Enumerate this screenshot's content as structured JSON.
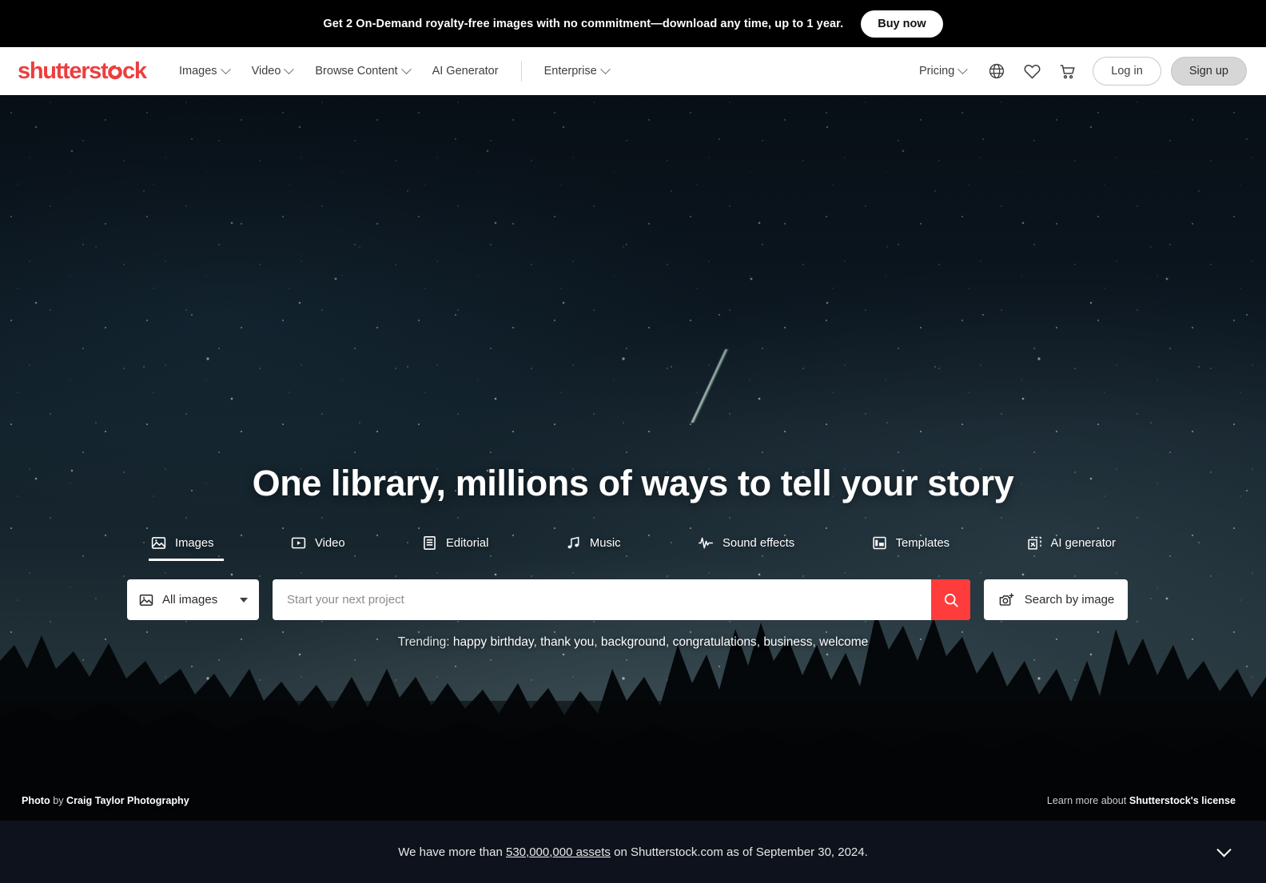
{
  "promo": {
    "text_bold_1": "Get 2 On-Demand",
    "text_light": " royalty-free images with no commitment—download any time, up to 1 year.",
    "full_text": "Get 2 On-Demand royalty-free images with no commitment—download any time, up to 1 year.",
    "button": "Buy now"
  },
  "header": {
    "logo": "shutterstock",
    "nav": [
      {
        "label": "Images",
        "has_caret": true
      },
      {
        "label": "Video",
        "has_caret": true
      },
      {
        "label": "Browse Content",
        "has_caret": true
      },
      {
        "label": "AI Generator",
        "has_caret": false
      },
      {
        "label": "Enterprise",
        "has_caret": true
      }
    ],
    "pricing": {
      "label": "Pricing",
      "has_caret": true
    },
    "icons": [
      "globe-icon",
      "heart-icon",
      "cart-icon"
    ],
    "login": "Log in",
    "signup": "Sign up",
    "brand_color": "#ec3e3e"
  },
  "hero": {
    "headline": "One library, millions of ways to tell your story",
    "tabs": [
      {
        "label": "Images",
        "icon": "image-icon",
        "active": true
      },
      {
        "label": "Video",
        "icon": "video-play-icon",
        "active": false
      },
      {
        "label": "Editorial",
        "icon": "document-lines-icon",
        "active": false
      },
      {
        "label": "Music",
        "icon": "music-note-icon",
        "active": false
      },
      {
        "label": "Sound effects",
        "icon": "waveform-icon",
        "active": false
      },
      {
        "label": "Templates",
        "icon": "layout-icon",
        "active": false
      },
      {
        "label": "AI generator",
        "icon": "ai-sparkle-icon",
        "active": false
      }
    ],
    "search": {
      "filter_label": "All images",
      "filter_icon": "image-icon",
      "placeholder": "Start your next project",
      "value": "",
      "submit_icon": "search-icon",
      "submit_color": "#ff3c3c",
      "image_search_label": "Search by image",
      "image_search_icon": "camera-plus-icon"
    },
    "trending": {
      "label": "Trending:",
      "terms": [
        "happy birthday",
        "thank you",
        "background",
        "congratulations",
        "business",
        "welcome"
      ]
    },
    "credit": {
      "prefix": "Photo",
      "by": "by",
      "author": "Craig Taylor Photography"
    },
    "license": {
      "prefix": "Learn more about ",
      "link": "Shutterstock's license"
    }
  },
  "footer": {
    "text_before": "We have more than ",
    "highlight": "530,000,000 assets",
    "text_after": " on Shutterstock.com as of September 30, 2024.",
    "chevron": "chevron-down-icon"
  }
}
